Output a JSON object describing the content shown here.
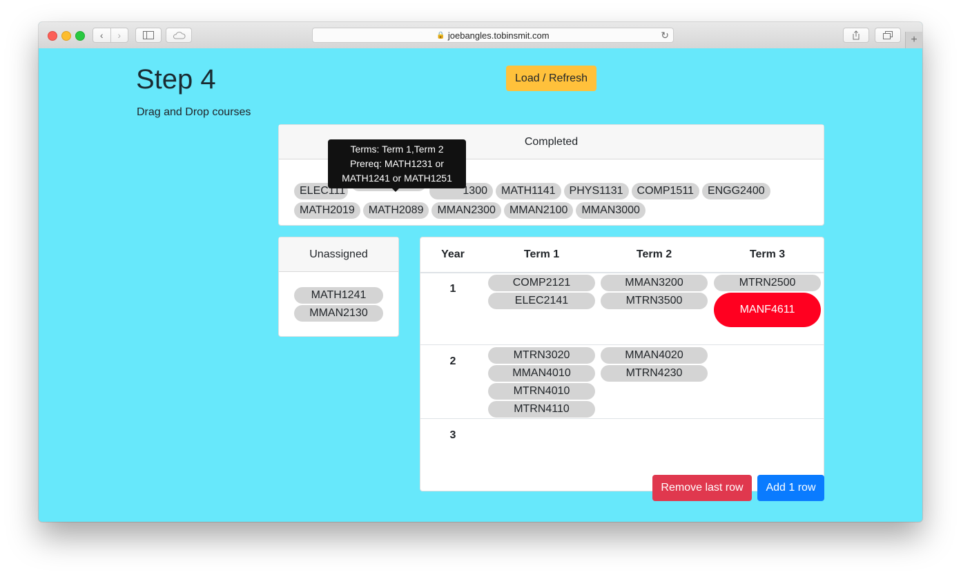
{
  "browser": {
    "url": "joebangles.tobinsmit.com",
    "lock_icon": "🔒",
    "reload_icon": "↻",
    "back_icon": "‹",
    "forward_icon": "›",
    "newtab_icon": "+"
  },
  "page": {
    "title": "Step 4",
    "subtitle": "Drag and Drop courses",
    "load_button": "Load / Refresh",
    "remove_button": "Remove last row",
    "add_button": "Add 1 row"
  },
  "completed": {
    "header": "Completed",
    "courses": [
      "ELEC1111",
      "MATH1131",
      "MATH1300",
      "MATH1141",
      "PHYS1131",
      "COMP1511",
      "ENGG2400",
      "MATH2019",
      "MATH2089",
      "MMAN2300",
      "MMAN2100",
      "MMAN3000"
    ],
    "visible_labels": [
      "ELEC111",
      "",
      "1300",
      "MATH1141",
      "PHYS1131",
      "COMP1511",
      "ENGG2400",
      "MATH2019",
      "MATH2089",
      "MMAN2300",
      "MMAN2100",
      "MMAN3000"
    ]
  },
  "tooltip": {
    "line1": "Terms: Term 1,Term 2",
    "line2": "Prereq: MATH1231 or",
    "line3": "MATH1241 or MATH1251"
  },
  "unassigned": {
    "header": "Unassigned",
    "courses": [
      "MATH1241",
      "MMAN2130"
    ]
  },
  "plan": {
    "headers": [
      "Year",
      "Term 1",
      "Term 2",
      "Term 3"
    ],
    "rows": [
      {
        "year": "1",
        "term1": [
          "COMP2121",
          "ELEC2141"
        ],
        "term2": [
          "MMAN3200",
          "MTRN3500"
        ],
        "term3": [
          "MTRN2500"
        ],
        "term3_highlight": "MANF4611"
      },
      {
        "year": "2",
        "term1": [
          "MTRN3020",
          "MMAN4010",
          "MTRN4010",
          "MTRN4110"
        ],
        "term2": [
          "MMAN4020",
          "MTRN4230"
        ],
        "term3": []
      },
      {
        "year": "3",
        "term1": [],
        "term2": [],
        "term3": []
      }
    ]
  },
  "colors": {
    "page_bg": "#67e8fb",
    "pill_bg": "#d4d4d4",
    "warning": "#ffc13b",
    "danger": "#e0384e",
    "primary": "#0a7bff",
    "highlight": "#ff0020"
  }
}
